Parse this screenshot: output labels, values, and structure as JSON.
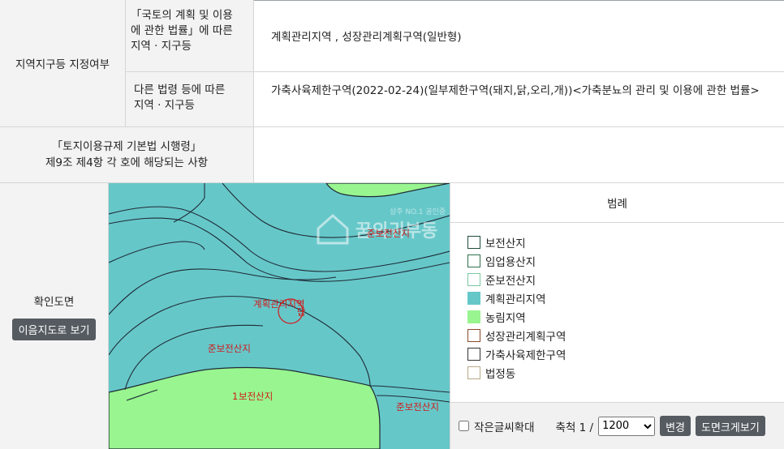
{
  "table": {
    "zone_label": "지역지구등 지정여부",
    "sub1_lines": [
      "「국토의 계획 및 이용",
      "에 관한 법률」에 따른",
      "지역 · 지구등"
    ],
    "val1": "계획관리지역 , 성장관리계획구역(일반형)",
    "sub2_lines": [
      "다른 법령 등에 따른",
      "지역 · 지구등"
    ],
    "val2": "가축사육제한구역(2022-02-24)(일부제한구역(돼지,닭,오리,개))<가축분뇨의 관리 및 이용에 관한 법률>",
    "reg_lines": [
      "「토지이용규제 기본법 시행령」",
      "제9조 제4항 각 호에 해당되는 사항"
    ],
    "reg_val": ""
  },
  "map_section": {
    "label": "확인도면",
    "land_map_button": "이음지도로 보기",
    "labels": {
      "top": "준보전산지",
      "center": "계획관리지역",
      "center_mark": "답",
      "left": "준보전산지",
      "bottom": "보전산지",
      "bottom_prefix": "1",
      "right": "준보전산지"
    },
    "watermark": {
      "small": "상주 NO.1 공인중",
      "big": "꿈의귀부동"
    },
    "colors": {
      "planning": "#66c7c9",
      "agri": "#98f58f",
      "boundary": "#1e2a35"
    }
  },
  "legend": {
    "title": "범례",
    "items": [
      {
        "label": "보전산지",
        "fill": "#ffffff",
        "border": "#1f4d3a"
      },
      {
        "label": "임업용산지",
        "fill": "#ffffff",
        "border": "#2f6f4a"
      },
      {
        "label": "준보전산지",
        "fill": "#ffffff",
        "border": "#7bc8a0"
      },
      {
        "label": "계획관리지역",
        "fill": "#66c7c9",
        "border": "#66c7c9"
      },
      {
        "label": "농림지역",
        "fill": "#98f58f",
        "border": "#98f58f"
      },
      {
        "label": "성장관리계획구역",
        "fill": "#ffffff",
        "border": "#8b4a2b"
      },
      {
        "label": "가축사육제한구역",
        "fill": "#ffffff",
        "border": "#333333"
      },
      {
        "label": "법정동",
        "fill": "#ffffff",
        "border": "#b8aa88"
      }
    ]
  },
  "controls": {
    "small_font_label": "작은글씨확대",
    "scale_label": "축척 1 /",
    "scale_value": "1200",
    "scale_options": [
      "1200"
    ],
    "change_button": "변경",
    "zoom_button": "도면크게보기"
  }
}
